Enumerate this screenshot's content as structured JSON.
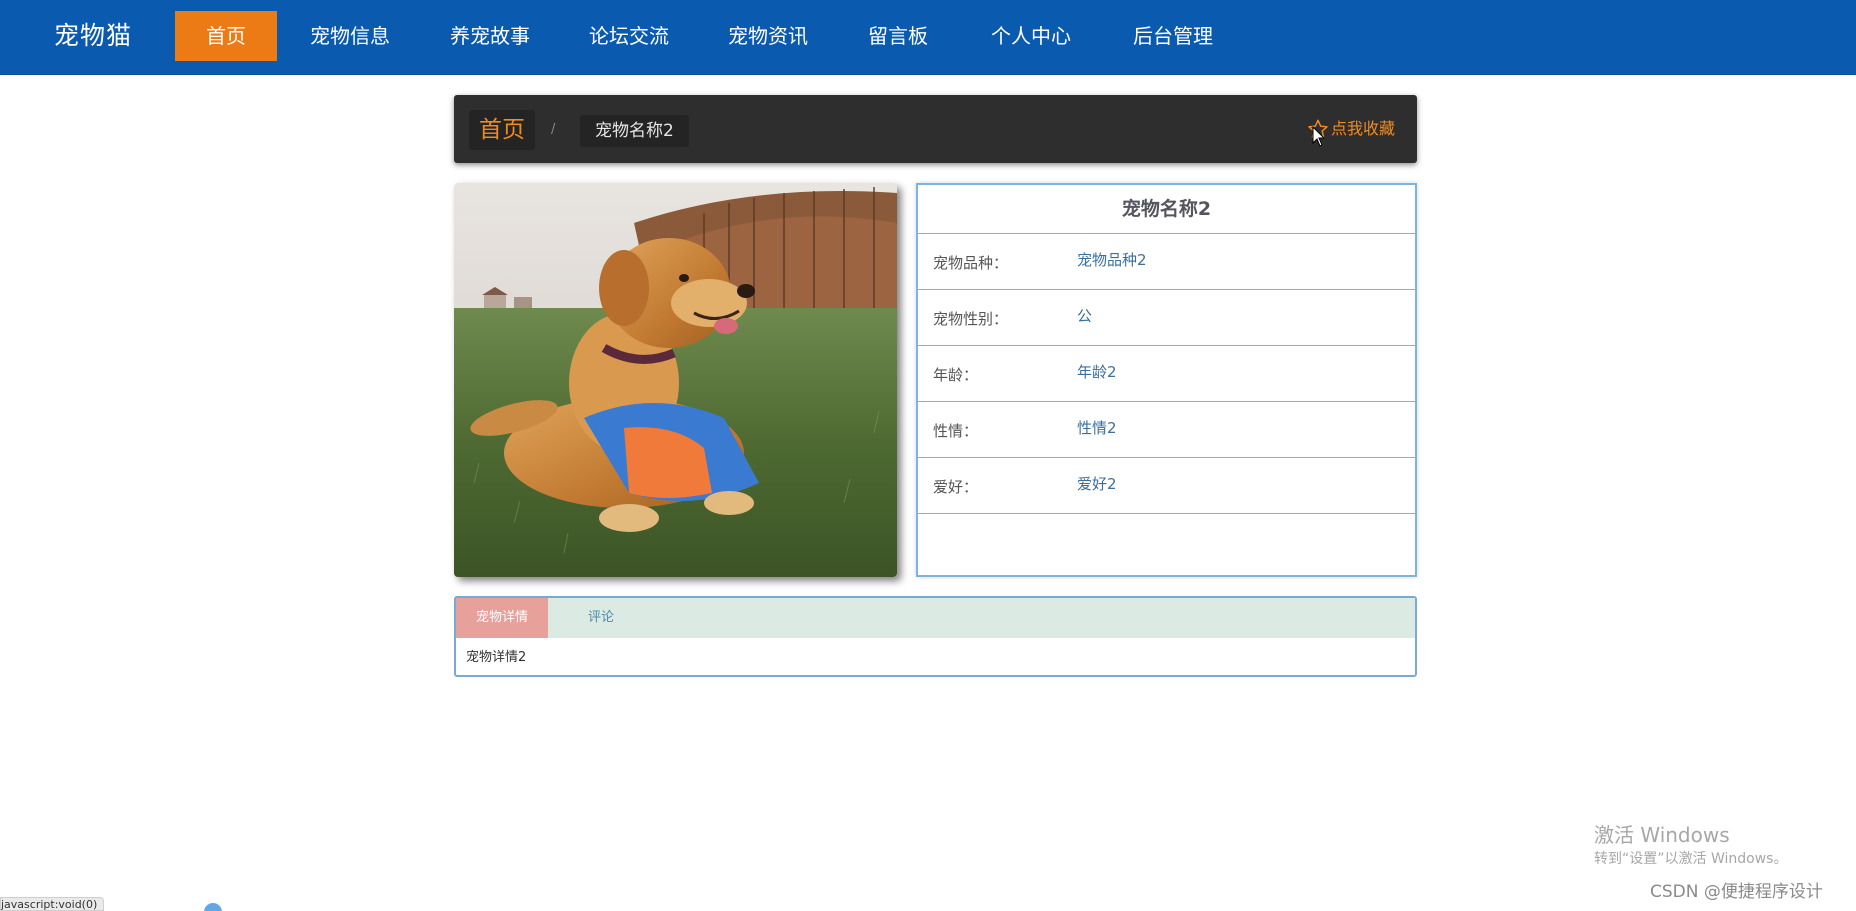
{
  "nav": {
    "brand": "宠物猫",
    "items": [
      {
        "label": "首页",
        "active": true
      },
      {
        "label": "宠物信息"
      },
      {
        "label": "养宠故事"
      },
      {
        "label": "论坛交流"
      },
      {
        "label": "宠物资讯"
      },
      {
        "label": "留言板"
      },
      {
        "label": "个人中心"
      },
      {
        "label": "后台管理"
      }
    ]
  },
  "breadcrumb": {
    "home": "首页",
    "separator": "/",
    "current": "宠物名称2",
    "favorite_label": "点我收藏",
    "favorite_icon": "star-outline-icon"
  },
  "pet": {
    "image_alt": "golden retriever lying on grass with a blue and orange toy",
    "title": "宠物名称2",
    "fields": [
      {
        "label": "宠物品种：",
        "value": "宠物品种2"
      },
      {
        "label": "宠物性别：",
        "value": "公"
      },
      {
        "label": "年龄：",
        "value": "年龄2"
      },
      {
        "label": "性情：",
        "value": "性情2"
      },
      {
        "label": "爱好：",
        "value": "爱好2"
      }
    ]
  },
  "tabs": {
    "items": [
      {
        "label": "宠物详情",
        "active": true
      },
      {
        "label": "评论"
      }
    ],
    "content": "宠物详情2"
  },
  "overlay": {
    "watermark_title": "激活 Windows",
    "watermark_sub": "转到“设置”以激活 Windows。",
    "credit": "CSDN @便捷程序设计",
    "status_url": "javascript:void(0)"
  },
  "colors": {
    "nav_bg": "#0a5bb0",
    "nav_active": "#ec7b16",
    "crumb_bg": "#2e2e2e",
    "accent_orange": "#f08a24",
    "card_border": "#7fb3d9",
    "tab_active": "#e8a09b",
    "tab_strip": "#dceae4"
  }
}
